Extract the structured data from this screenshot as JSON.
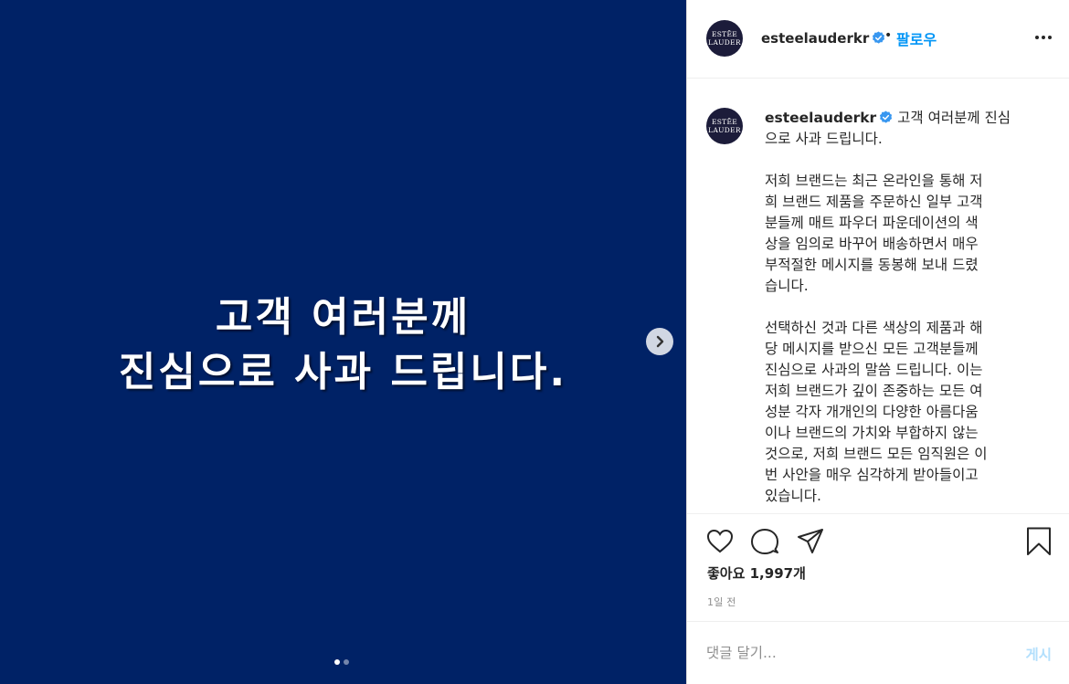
{
  "media": {
    "headline_lines": [
      "고객 여러분께",
      "진심으로 사과 드립니다."
    ],
    "background_color": "#002266",
    "next_icon": "chevron-right-icon",
    "slide_count": 2,
    "active_slide": 1
  },
  "header": {
    "avatar_text_line1": "ESTĒE",
    "avatar_text_line2": "LAUDER",
    "username": "esteelauderkr",
    "separator": "•",
    "follow_label": "팔로우",
    "verified_icon": "verified-badge-icon",
    "more_icon": "more-options-icon"
  },
  "caption": {
    "avatar_text_line1": "ESTĒE",
    "avatar_text_line2": "LAUDER",
    "username": "esteelauderkr",
    "lines_first": [
      "고객 여러분께 진심",
      "으로 사과 드립니다."
    ],
    "paragraph1_lines": [
      "저희 브랜드는 최근 온라인을 통해 저",
      "희 브랜드 제품을 주문하신 일부 고객",
      "분들께 매트 파우더 파운데이션의 색",
      "상을 임의로 바꾸어 배송하면서 매우",
      "부적절한 메시지를 동봉해 보내 드렸",
      "습니다."
    ],
    "paragraph2_lines": [
      "선택하신 것과 다른 색상의 제품과 해",
      "당 메시지를 받으신 모든 고객분들께",
      "진심으로 사과의 말씀 드립니다. 이는",
      "저희 브랜드가 깊이 존중하는 모든 여",
      "성분 각자 개개인의 다양한 아름다움",
      "이나 브랜드의 가치와 부합하지 않는",
      "것으로, 저희 브랜드 모든 임직원은 이",
      "번 사안을 매우 심각하게 받아들이고",
      "있습니다."
    ]
  },
  "actions": {
    "like_icon": "heart-icon",
    "comment_icon": "comment-icon",
    "share_icon": "share-icon",
    "save_icon": "bookmark-icon",
    "likes_text": "좋아요 1,997개",
    "time_ago": "1일 전"
  },
  "comment_box": {
    "placeholder": "댓글 달기...",
    "post_label": "게시"
  },
  "colors": {
    "accent": "#0095f6",
    "post_disabled": "#b2dffc",
    "verified": "#3897f0"
  }
}
